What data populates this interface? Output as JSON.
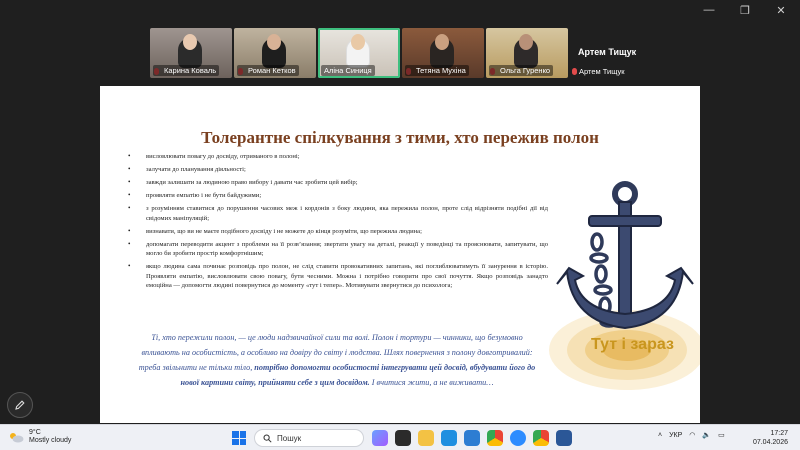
{
  "participants": [
    {
      "name": "Карина Коваль",
      "muted": true
    },
    {
      "name": "Роман Кетков",
      "muted": true
    },
    {
      "name": "Аліна Синиця",
      "muted": false
    },
    {
      "name": "Тетяна Мухіна",
      "muted": true
    },
    {
      "name": "Ольга Гуренко",
      "muted": true
    }
  ],
  "speaker": {
    "name": "Артем Тищук",
    "label": "Артем Тищук"
  },
  "slide": {
    "title": "Толерантне спілкування з тими, хто пережив полон",
    "bullets": [
      "висловлювати повагу до досвіду, отриманого в полоні;",
      "залучати до планування діяльності;",
      "завжди залишати за людиною право вибору і давати час зробити цей вибір;",
      "проявляти емпатію і не бути байдужими;",
      "з розумінням ставитися до порушення часових меж і кордонів з боку людини, яка пережила полон, проте слід відрізняти подібні дії від свідомих маніпуляцій;",
      "визнавати, що ви не маєте подібного досвіду і не можете до кінця розуміти, що пережила людина;",
      "допомагати переводити акцент з проблеми на її розв’язання; звертати увагу на деталі, реакції у поведінці та прояснювати, запитувати, що могло би зробити простір комфортнішим;",
      "якщо людина сама починає розповідь про полон, не слід ставити провокативних запитань, які поглиблюватимуть її занурення в історію. Проявляти емпатію, висловлювати свою повагу, бути чесними. Можна і потрібно говорити про свої почуття. Якщо розповідь занадто емоційна — допомогти людині повернутися до моменту «тут і тепер». Мотивувати звернутися до психолога;"
    ],
    "quote_1": "Ті, хто пережили полон, — це люди надзвичайної сили та волі. Полон і тортури — чинники, що безумовно впливають на особистість, а особливо на довіру до світу і людства. Шлях повернення з полону довготривалий: треба звільнити не тільки тіло, ",
    "quote_bold_1": "потрібно допомогти особистості інтегрувати цей досвід, вбудувати його до нової картини світу, прийняти себе з цим досвідом.",
    "quote_2": " І вчитися жити, а не виживати…",
    "image_caption": "Тут і зараз"
  },
  "taskbar": {
    "weather_temp": "9°C",
    "weather_desc": "Mostly cloudy",
    "search_placeholder": "Пошук",
    "language": "УКР",
    "time": "17:27",
    "date": "07.04.2026"
  },
  "colors": {
    "title": "#7a4020",
    "quote": "#3a5294",
    "caption": "#c9961e",
    "active_tile": "#3fbf7f"
  }
}
